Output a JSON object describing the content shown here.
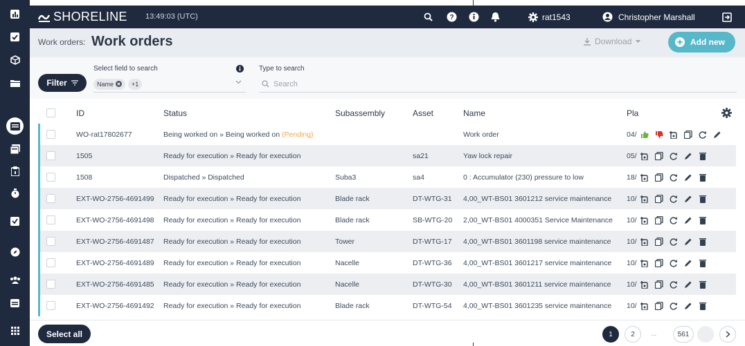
{
  "app": {
    "brand": "SHORELINE",
    "clock": "13:49:03 (UTC)",
    "user_id": "rat1543",
    "user_name": "Christopher Marshall"
  },
  "header": {
    "breadcrumb": "Work orders:",
    "title": "Work orders",
    "download_label": "Download",
    "add_label": "Add new"
  },
  "filter": {
    "button_label": "Filter",
    "field_label": "Select field to search",
    "chip_label": "Name",
    "chip_more": "+1",
    "search_label": "Type to search",
    "search_placeholder": "Search"
  },
  "table": {
    "columns": [
      "ID",
      "Status",
      "Subassembly",
      "Asset",
      "Name",
      "Pla"
    ],
    "rows": [
      {
        "id": "WO-rat17802677",
        "status": "Being worked on » Being worked on",
        "status_note": "(Pending)",
        "sub": "",
        "asset": "",
        "name": "Work order",
        "plan": "04/"
      },
      {
        "id": "1505",
        "status": "Ready for execution » Ready for execution",
        "status_note": "",
        "sub": "",
        "asset": "sa21",
        "name": "Yaw lock repair",
        "plan": "05/"
      },
      {
        "id": "1508",
        "status": "Dispatched » Dispatched",
        "status_note": "",
        "sub": "Suba3",
        "asset": "sa4",
        "name": "0 : Accumulator (230) pressure to low",
        "plan": "18/"
      },
      {
        "id": "EXT-WO-2756-4691499",
        "status": "Ready for execution » Ready for execution",
        "status_note": "",
        "sub": "Blade rack",
        "asset": "DT-WTG-31",
        "name": "4,00_WT-BS01 3601212 service maintenance",
        "plan": "10/"
      },
      {
        "id": "EXT-WO-2756-4691498",
        "status": "Ready for execution » Ready for execution",
        "status_note": "",
        "sub": "Blade rack",
        "asset": "SB-WTG-20",
        "name": "2,00_WT-BS01 4000351 Service Maintenance",
        "plan": "10/"
      },
      {
        "id": "EXT-WO-2756-4691487",
        "status": "Ready for execution » Ready for execution",
        "status_note": "",
        "sub": "Tower",
        "asset": "DT-WTG-17",
        "name": "4,00_WT-BS01 3601198 service maintenance",
        "plan": "10/"
      },
      {
        "id": "EXT-WO-2756-4691489",
        "status": "Ready for execution » Ready for execution",
        "status_note": "",
        "sub": "Nacelle",
        "asset": "DT-WTG-36",
        "name": "4,00_WT-BS01 3601217 service maintenance",
        "plan": "10/"
      },
      {
        "id": "EXT-WO-2756-4691485",
        "status": "Ready for execution » Ready for execution",
        "status_note": "",
        "sub": "Nacelle",
        "asset": "DT-WTG-30",
        "name": "4,00_WT-BS01 3601211 service maintenance",
        "plan": "10/"
      },
      {
        "id": "EXT-WO-2756-4691492",
        "status": "Ready for execution » Ready for execution",
        "status_note": "",
        "sub": "Blade rack",
        "asset": "DT-WTG-54",
        "name": "4,00_WT-BS01 3601235 service maintenance",
        "plan": "10/"
      }
    ]
  },
  "footer": {
    "select_all": "Select all",
    "pages": [
      "1",
      "2",
      "...",
      "561"
    ]
  },
  "colors": {
    "nav": "#1f2a3f",
    "accent": "#56b8c8",
    "pending": "#f2a84b",
    "like": "#6cb33f",
    "dislike": "#d9342b"
  },
  "icons": {
    "rail": [
      "dashboard-icon",
      "checkbox-icon",
      "cube-icon",
      "folder-icon",
      "workorders-icon",
      "stack-icon",
      "clipboard-icon",
      "stopwatch-icon",
      "approve-icon",
      "compass-icon",
      "team-icon",
      "calendar-icon",
      "apps-grid-icon"
    ]
  }
}
